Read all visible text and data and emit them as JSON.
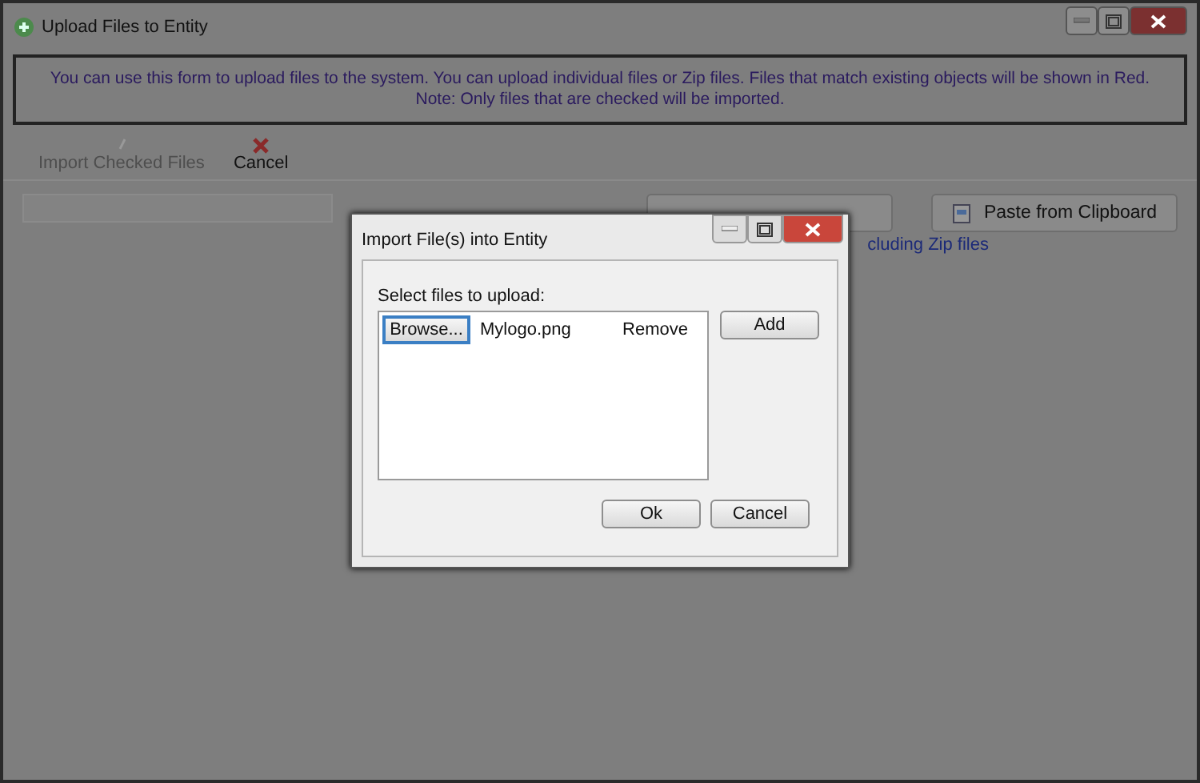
{
  "window": {
    "title": "Upload Files to Entity"
  },
  "info": [
    "You can use this form to upload files to the system. You can upload individual files or Zip files. Files that match existing objects will be shown in Red.",
    "Note: Only files that are checked will be imported."
  ],
  "toolbar": [
    {
      "label": "Import Checked Files",
      "disabled": true
    },
    {
      "label": "Cancel",
      "disabled": false
    }
  ],
  "paste_button": "Paste from Clipboard",
  "hint": "cluding Zip files",
  "dialog": {
    "title": "Import File(s) into Entity",
    "prompt": "Select files to upload:",
    "files": [
      {
        "browse": "Browse...",
        "name": "Mylogo.png",
        "remove": "Remove"
      }
    ],
    "add": "Add",
    "buttons": [
      "Ok",
      "Cancel"
    ]
  }
}
